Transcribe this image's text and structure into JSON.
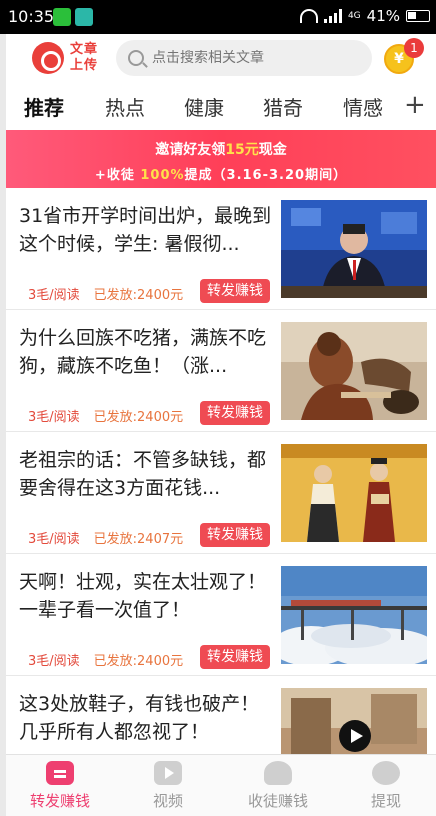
{
  "status_bar": {
    "time": "10:35",
    "network": "4G",
    "battery": "41%"
  },
  "header": {
    "logo_text": "文章上传",
    "search_placeholder": "点击搜索相关文章",
    "coin_symbol": "¥",
    "coin_badge": "1"
  },
  "tabs": [
    "推荐",
    "热点",
    "健康",
    "猎奇",
    "情感"
  ],
  "tab_add": "+",
  "banner": {
    "line1_pre": "邀请好友领",
    "line1_hl": "15元",
    "line1_post": "现金",
    "line2_pre": "+收徒",
    "line2_hl": "100%",
    "line2_post": "提成（3.16-3.20期间）"
  },
  "articles": [
    {
      "title": "31省市开学时间出炉，最晚到这个时候，学生: 暑假彻...",
      "rate": "3毛/阅读",
      "paid": "已发放:2400元",
      "action": "转发赚钱"
    },
    {
      "title": "为什么回族不吃猪，满族不吃狗，藏族不吃鱼！（涨...",
      "rate": "3毛/阅读",
      "paid": "已发放:2400元",
      "action": "转发赚钱"
    },
    {
      "title": "老祖宗的话：不管多缺钱，都要舍得在这3方面花钱...",
      "rate": "3毛/阅读",
      "paid": "已发放:2407元",
      "action": "转发赚钱"
    },
    {
      "title": "天啊！壮观，实在太壮观了！一辈子看一次值了！",
      "rate": "3毛/阅读",
      "paid": "已发放:2400元",
      "action": "转发赚钱"
    },
    {
      "title": "这3处放鞋子，有钱也破产！几乎所有人都忽视了！",
      "rate": "",
      "paid": "",
      "action": ""
    }
  ],
  "bottom_nav": [
    {
      "label": "转发赚钱",
      "active": true
    },
    {
      "label": "视频",
      "active": false
    },
    {
      "label": "收徒赚钱",
      "active": false
    },
    {
      "label": "提现",
      "active": false
    }
  ],
  "colors": {
    "accent": "#ef4b53",
    "nav_active": "#ee3f70",
    "banner": "#ff3f58",
    "highlight": "#ffe14a"
  }
}
